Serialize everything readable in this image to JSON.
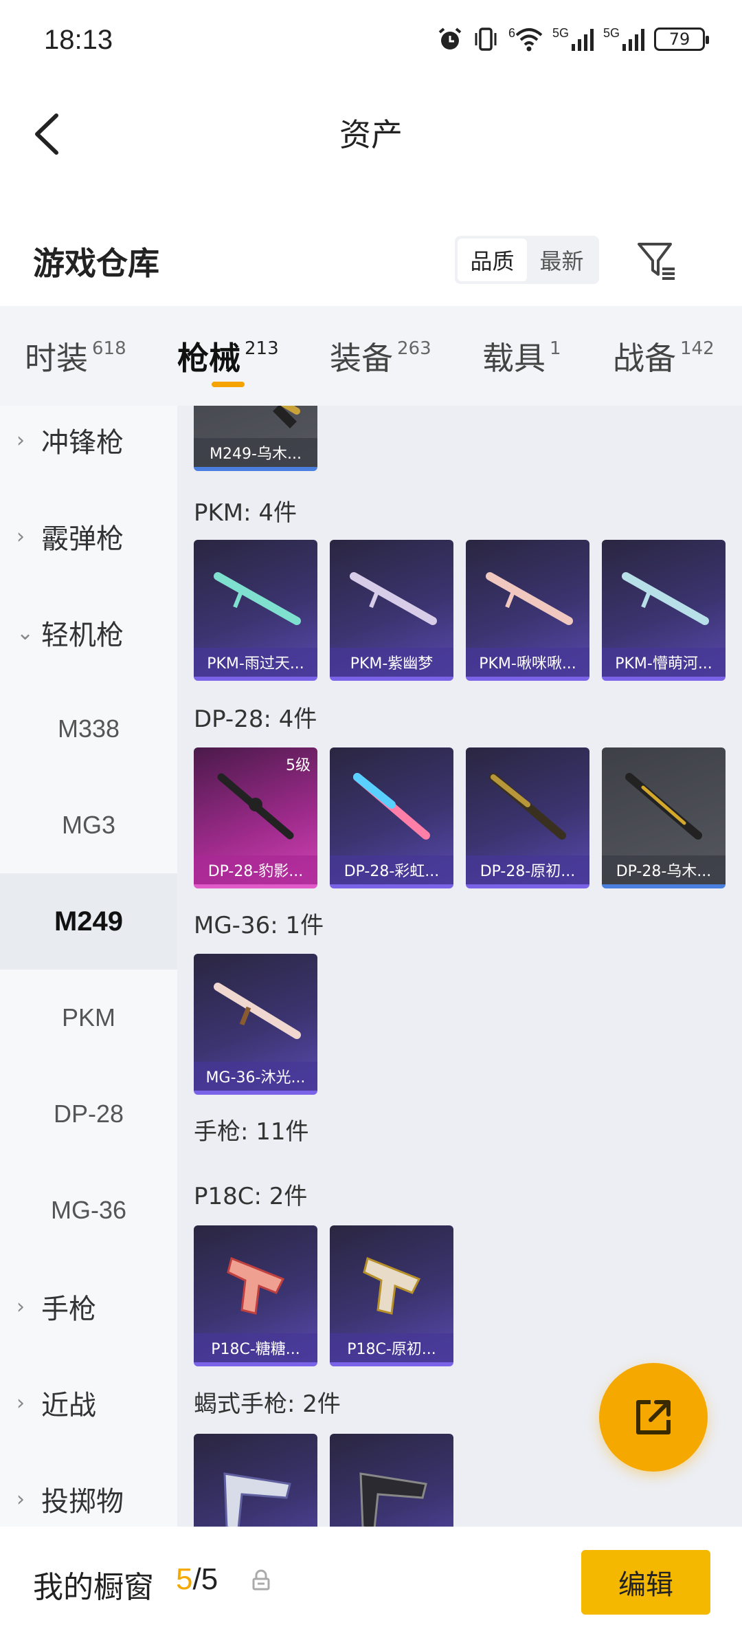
{
  "status_bar": {
    "time": "18:13",
    "battery": "79",
    "net1": "5G",
    "net2": "5G",
    "wifi_tag": "6"
  },
  "nav": {
    "title": "资产"
  },
  "warehouse": {
    "title": "游戏仓库",
    "sort_quality": "品质",
    "sort_latest": "最新"
  },
  "tabs": [
    {
      "label": "时装",
      "count": "618"
    },
    {
      "label": "枪械",
      "count": "213"
    },
    {
      "label": "装备",
      "count": "263"
    },
    {
      "label": "载具",
      "count": "1"
    },
    {
      "label": "战备",
      "count": "142"
    }
  ],
  "sidebar": {
    "items": [
      {
        "label": "冲锋枪"
      },
      {
        "label": "霰弹枪"
      },
      {
        "label": "轻机枪"
      },
      {
        "label": "M338"
      },
      {
        "label": "MG3"
      },
      {
        "label": "M249"
      },
      {
        "label": "PKM"
      },
      {
        "label": "DP-28"
      },
      {
        "label": "MG-36"
      },
      {
        "label": "手枪"
      },
      {
        "label": "近战"
      },
      {
        "label": "投掷物"
      }
    ]
  },
  "content": {
    "top_partial": {
      "name": "M249-乌木..."
    },
    "groups": [
      {
        "label": "PKM: 4件",
        "items": [
          {
            "name": "PKM-雨过天..."
          },
          {
            "name": "PKM-紫幽梦"
          },
          {
            "name": "PKM-啾咪啾..."
          },
          {
            "name": "PKM-懵萌河..."
          }
        ]
      },
      {
        "label": "DP-28: 4件",
        "items": [
          {
            "name": "DP-28-豹影...",
            "level": "5级"
          },
          {
            "name": "DP-28-彩虹..."
          },
          {
            "name": "DP-28-原初..."
          },
          {
            "name": "DP-28-乌木..."
          }
        ]
      },
      {
        "label": "MG-36: 1件",
        "items": [
          {
            "name": "MG-36-沐光..."
          }
        ]
      },
      {
        "label": "手枪: 11件"
      },
      {
        "label": "P18C: 2件",
        "items": [
          {
            "name": "P18C-糖糖..."
          },
          {
            "name": "P18C-原初..."
          }
        ]
      },
      {
        "label": "蝎式手枪: 2件"
      }
    ]
  },
  "bottom": {
    "showcase_label": "我的橱窗",
    "showcase_current": "5",
    "showcase_sep": "/",
    "showcase_total": "5",
    "edit": "编辑"
  },
  "colors": {
    "accent": "#f5a800",
    "edit_button": "#f5b800",
    "rarity_purple": "#7b63e8",
    "rarity_pink": "#e05ac8",
    "rarity_blue": "#4a7fe0"
  }
}
